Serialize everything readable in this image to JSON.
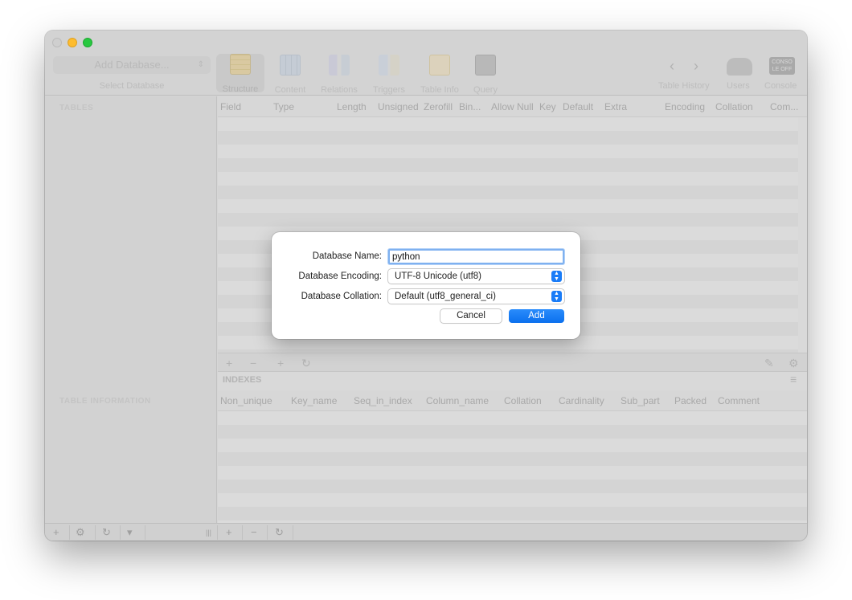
{
  "toolbar": {
    "db_select": "Add Database...",
    "db_caption": "Select Database",
    "items": [
      {
        "label": "Structure",
        "icon": "structure-icon"
      },
      {
        "label": "Content",
        "icon": "content-icon"
      },
      {
        "label": "Relations",
        "icon": "relations-icon"
      },
      {
        "label": "Triggers",
        "icon": "triggers-icon"
      },
      {
        "label": "Table Info",
        "icon": "table-info-icon"
      },
      {
        "label": "Query",
        "icon": "query-icon"
      }
    ],
    "history_label": "Table History",
    "users_label": "Users",
    "console_label": "Console",
    "console_icon_text": "CONSO LE OFF"
  },
  "sidebar": {
    "tables_header": "TABLES",
    "info_header": "TABLE INFORMATION"
  },
  "structure_grid": {
    "columns": [
      "Field",
      "Type",
      "Length",
      "Unsigned",
      "Zerofill",
      "Bin...",
      "Allow Null",
      "Key",
      "Default",
      "Extra",
      "Encoding",
      "Collation",
      "Com..."
    ]
  },
  "indexes": {
    "header": "INDEXES",
    "columns": [
      "Non_unique",
      "Key_name",
      "Seq_in_index",
      "Column_name",
      "Collation",
      "Cardinality",
      "Sub_part",
      "Packed",
      "Comment"
    ]
  },
  "dialog": {
    "name_label": "Database Name:",
    "name_value": "python",
    "encoding_label": "Database Encoding:",
    "encoding_value": "UTF-8 Unicode (utf8)",
    "collation_label": "Database Collation:",
    "collation_value": "Default (utf8_general_ci)",
    "cancel_label": "Cancel",
    "add_label": "Add",
    "accent_color": "#0b70ee"
  },
  "glyphs": {
    "plus": "+",
    "minus": "−",
    "refresh": "↻",
    "gear": "⚙",
    "prev": "‹",
    "next": "›",
    "updown": "⇕",
    "pencil": "✎",
    "menu": "≡",
    "split": "|||",
    "filter": "▾"
  }
}
